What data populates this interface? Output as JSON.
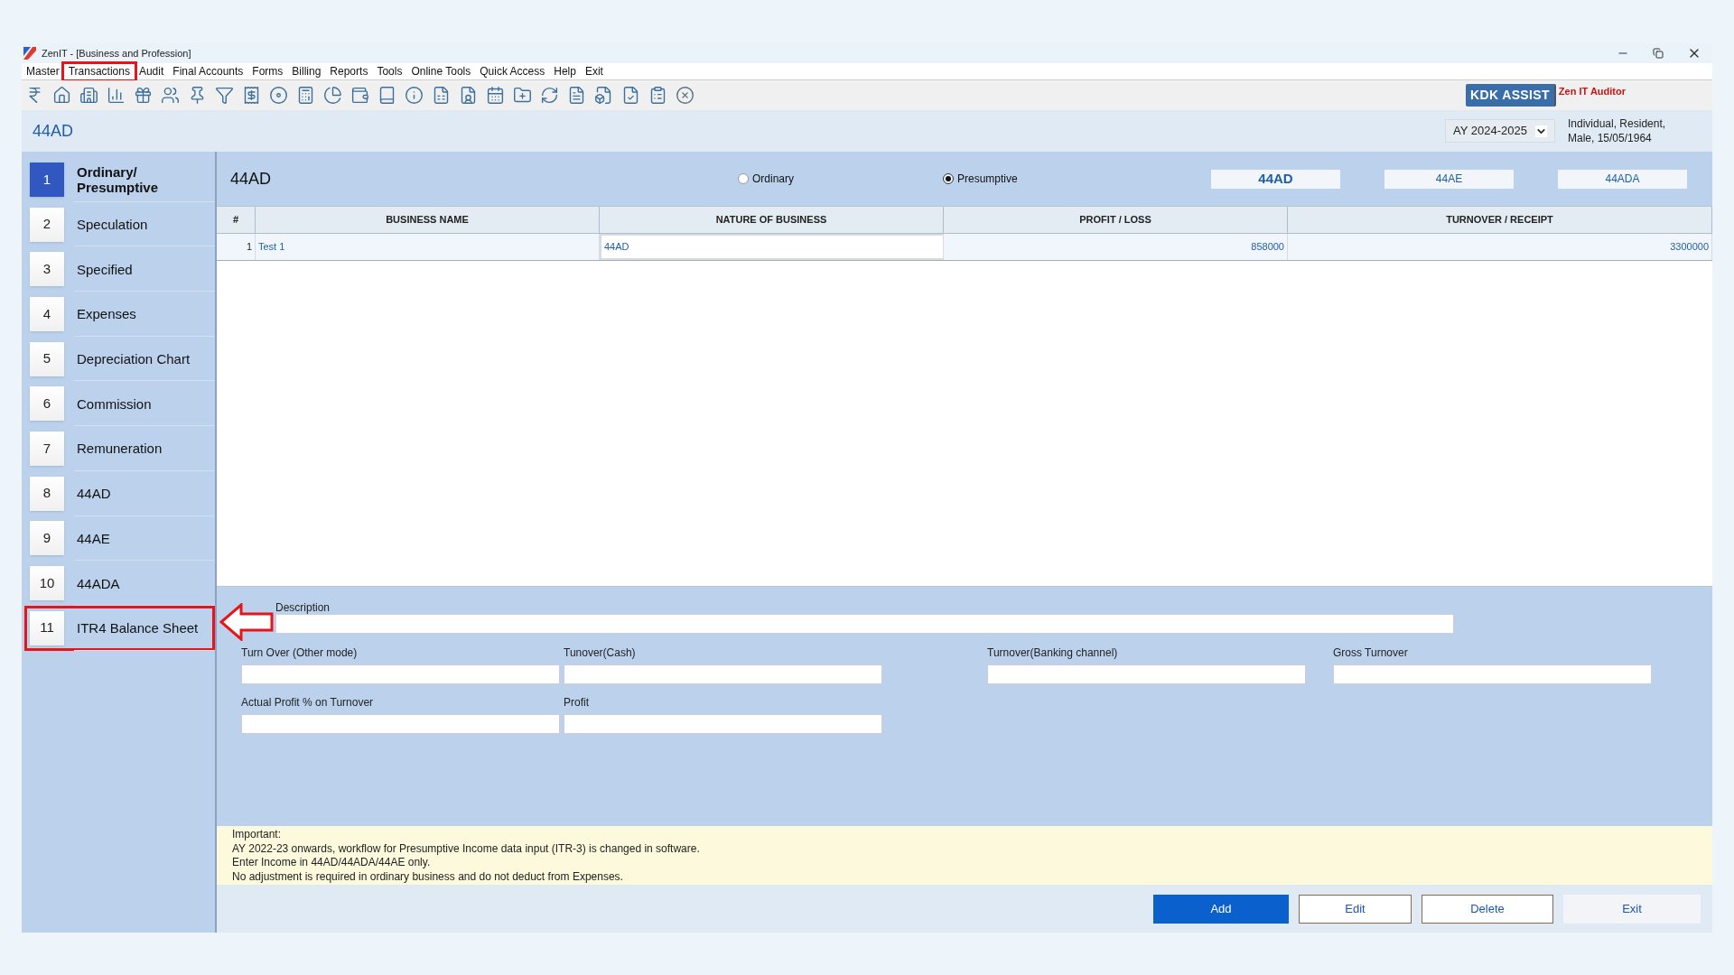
{
  "window": {
    "title": "ZenIT - [Business and Profession]"
  },
  "menu": [
    {
      "label": "Master",
      "highlighted": false
    },
    {
      "label": "Transactions",
      "highlighted": true
    },
    {
      "label": "Audit",
      "highlighted": false
    },
    {
      "label": "Final Accounts",
      "highlighted": false
    },
    {
      "label": "Forms",
      "highlighted": false
    },
    {
      "label": "Billing",
      "highlighted": false
    },
    {
      "label": "Reports",
      "highlighted": false
    },
    {
      "label": "Tools",
      "highlighted": false
    },
    {
      "label": "Online Tools",
      "highlighted": false
    },
    {
      "label": "Quick Access",
      "highlighted": false
    },
    {
      "label": "Help",
      "highlighted": false
    },
    {
      "label": "Exit",
      "highlighted": false
    }
  ],
  "assist": {
    "badge": "KDK ASSIST",
    "product": "Zen IT Auditor"
  },
  "header": {
    "title": "44AD",
    "year": "AY 2024-2025",
    "profile": [
      "Individual, Resident,",
      "Male, 15/05/1964"
    ]
  },
  "sidebar": {
    "items": [
      {
        "number": "1",
        "label": "Ordinary/ Presumptive",
        "selected": true,
        "highlighted": false
      },
      {
        "number": "2",
        "label": "Speculation",
        "selected": false,
        "highlighted": false
      },
      {
        "number": "3",
        "label": "Specified",
        "selected": false,
        "highlighted": false
      },
      {
        "number": "4",
        "label": "Expenses",
        "selected": false,
        "highlighted": false
      },
      {
        "number": "5",
        "label": "Depreciation Chart",
        "selected": false,
        "highlighted": false
      },
      {
        "number": "6",
        "label": "Commission",
        "selected": false,
        "highlighted": false
      },
      {
        "number": "7",
        "label": "Remuneration",
        "selected": false,
        "highlighted": false
      },
      {
        "number": "8",
        "label": "44AD",
        "selected": false,
        "highlighted": false
      },
      {
        "number": "9",
        "label": "44AE",
        "selected": false,
        "highlighted": false
      },
      {
        "number": "10",
        "label": "44ADA",
        "selected": false,
        "highlighted": false
      },
      {
        "number": "11",
        "label": "ITR4 Balance Sheet",
        "selected": false,
        "highlighted": true
      }
    ]
  },
  "panel": {
    "title": "44AD",
    "modes": [
      {
        "label": "Ordinary",
        "selected": false
      },
      {
        "label": "Presumptive",
        "selected": true
      }
    ],
    "tabs": [
      {
        "label": "44AD",
        "selected": true
      },
      {
        "label": "44AE",
        "selected": false
      },
      {
        "label": "44ADA",
        "selected": false
      }
    ]
  },
  "table": {
    "columns": [
      "#",
      "BUSINESS NAME",
      "NATURE OF BUSINESS",
      "PROFIT / LOSS",
      "TURNOVER / RECEIPT"
    ],
    "rows": [
      {
        "cells": [
          "1",
          "Test 1",
          "44AD",
          "858000",
          "3300000"
        ]
      }
    ]
  },
  "form": {
    "description": "Description",
    "row1": [
      "Turn Over (Other mode)",
      "Tunover(Cash)",
      "Turnover(Banking channel)",
      "Gross Turnover"
    ],
    "row2": [
      "Actual Profit % on Turnover",
      "Profit"
    ]
  },
  "notes": [
    "Important:",
    "AY 2022-23 onwards, workflow for Presumptive Income data input (ITR-3) is changed in software.",
    "Enter Income in 44AD/44ADA/44AE only.",
    "No adjustment is required in ordinary business and do not deduct from Expenses."
  ],
  "buttons": [
    {
      "label": "Add",
      "kind": "primary"
    },
    {
      "label": "Edit",
      "kind": "outline"
    },
    {
      "label": "Delete",
      "kind": "outline"
    },
    {
      "label": "Exit",
      "kind": "plain"
    }
  ]
}
